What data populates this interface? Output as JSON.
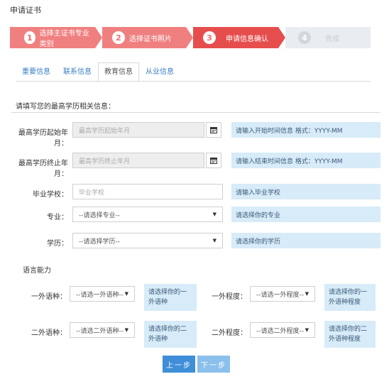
{
  "page": {
    "title": "申请证书"
  },
  "steps": [
    {
      "num": "1",
      "label": "选择主证书专业类别"
    },
    {
      "num": "2",
      "label": "选择证书照片"
    },
    {
      "num": "3",
      "label": "申请信息确认"
    },
    {
      "num": "4",
      "label": "完成"
    }
  ],
  "tabs": [
    "重要信息",
    "联系信息",
    "教育信息",
    "从业信息"
  ],
  "section": {
    "title": "请填写您的最高学历相关信息："
  },
  "form": {
    "start": {
      "label": "最高学历起始年月：",
      "placeholder": "最高学历起始年月",
      "hint": "请输入开始时间信息  格式：YYYY-MM"
    },
    "end": {
      "label": "最高学历终止年月：",
      "placeholder": "最高学历终止年月",
      "hint": "请输入结束时间信息  格式：YYYY-MM"
    },
    "school": {
      "label": "毕业学校：",
      "placeholder": "毕业学校",
      "hint": "请输入毕业学校"
    },
    "major": {
      "label": "专业：",
      "value": "--请选择专业--",
      "hint": "请选择你的专业"
    },
    "degree": {
      "label": "学历：",
      "value": "--请选择学历--",
      "hint": "请选择你的学历"
    }
  },
  "language": {
    "title": "语言能力",
    "first_lang": {
      "label": "一外语种：",
      "value": "--请选一外语种--",
      "hint": "请选择你的一外语种"
    },
    "first_level": {
      "label": "一外程度：",
      "value": "--请选一外程度--",
      "hint": "请选择你的一外语种程度"
    },
    "second_lang": {
      "label": "二外语种：",
      "value": "--请选二外语种--",
      "hint": "请选择你的二外语种"
    },
    "second_level": {
      "label": "二外程度：",
      "value": "--请选二外程度--",
      "hint": "请选择你的二外语种程度"
    }
  },
  "buttons": {
    "prev": "上一步",
    "next": "下一步"
  },
  "colors": {
    "step_done": "#f08080",
    "step_current": "#e64e4e",
    "step_todo": "#e9edf2",
    "hint_bg": "#d7ebf8",
    "primary": "#3f8ed8"
  },
  "icons": {
    "calendar": "calendar-icon",
    "caret": "caret-down-icon"
  }
}
